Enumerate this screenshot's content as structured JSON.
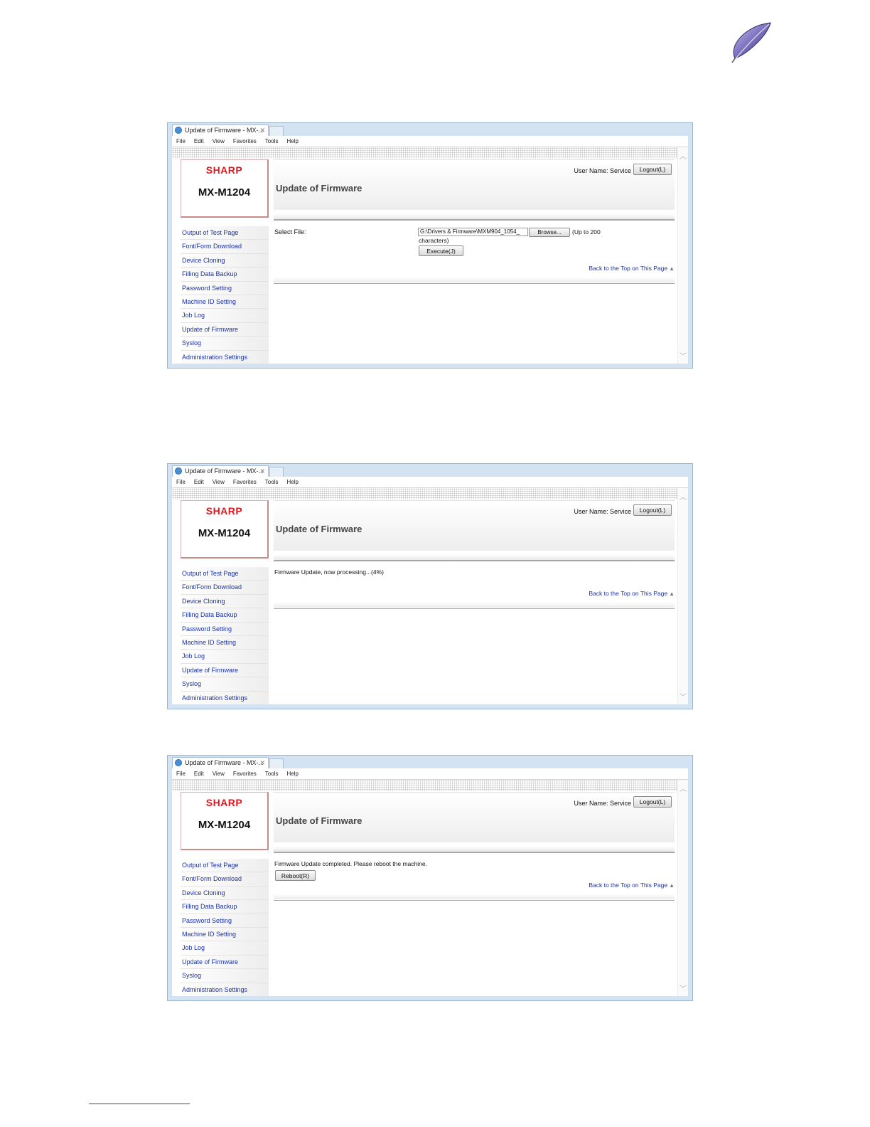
{
  "colors": {
    "brand_red": "#e0181f",
    "nav_link": "#1a32a8",
    "frame_blue": "#d3e3f1"
  },
  "icons": {
    "corner_logo": "feather-icon",
    "tab_icon": "ie-icon",
    "back_to_top": "triangle-up-icon"
  },
  "browser": {
    "tab_title": "Update of Firmware - MX-...",
    "tab_close": "✕",
    "menu": [
      "File",
      "Edit",
      "View",
      "Favorites",
      "Tools",
      "Help"
    ],
    "scroll_up": "︿",
    "scroll_down": "﹀"
  },
  "page": {
    "brand": "SHARP",
    "model": "MX-M1204",
    "user_name": "User Name: Service",
    "logout": "Logout(L)",
    "title": "Update of Firmware",
    "back_to_top": "Back to the Top on This Page",
    "back_to_top_symbol": "▲",
    "nav": [
      "Output of Test Page",
      "Font/Form Download",
      "Device Cloning",
      "Filling Data Backup",
      "Password Setting",
      "Machine ID Setting",
      "Job Log",
      "Update of Firmware",
      "Syslog",
      "Administration Settings"
    ]
  },
  "screen1": {
    "select_file_label": "Select File:",
    "file_path": "G:\\Drivers & Firmware\\MXM904_1054_",
    "browse": "Browse...",
    "limit_note_a": "(Up to 200",
    "limit_note_b": "characters)",
    "execute": "Execute(J)"
  },
  "screen2": {
    "status": "Firmware Update, now processing...(4%)",
    "progress_percent": 4
  },
  "screen3": {
    "status": "Firmware Update completed. Please reboot the machine.",
    "reboot": "Reboot(R)"
  }
}
